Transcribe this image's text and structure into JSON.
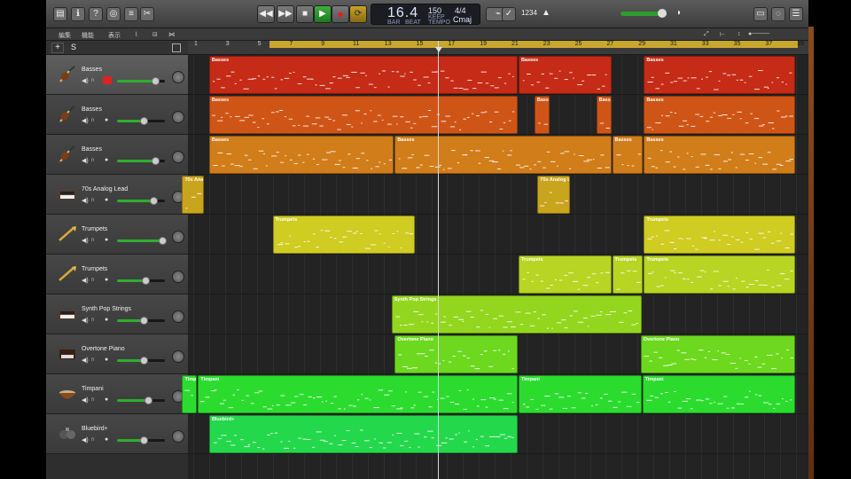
{
  "control_bar": {
    "lcd": {
      "position": "16.4",
      "position_bar_label": "BAR",
      "position_beat_label": "BEAT",
      "tempo": "150",
      "tempo_label": "KEEP",
      "tempo_sub": "TEMPO",
      "signature": "4/4",
      "key": "Cmaj"
    },
    "count_in": "1234"
  },
  "track_toolbar": {
    "menus": [
      "編集",
      "機能",
      "表示"
    ]
  },
  "addbar": {
    "plus": "+",
    "s": "S"
  },
  "ruler": {
    "bars": [
      "1",
      "3",
      "5",
      "7",
      "9",
      "11",
      "13",
      "15",
      "17",
      "19",
      "21",
      "23",
      "25",
      "27",
      "29",
      "31",
      "33",
      "35",
      "37",
      "39"
    ]
  },
  "tracks": [
    {
      "name": "Basses",
      "icon": "violin-icon",
      "color": "#c52b16",
      "volume": 0.8,
      "selected": true,
      "record": true
    },
    {
      "name": "Basses",
      "icon": "violin-icon",
      "color": "#cf5517",
      "volume": 0.55,
      "selected": false,
      "record": false
    },
    {
      "name": "Basses",
      "icon": "violin-icon",
      "color": "#d17d1a",
      "volume": 0.8,
      "selected": false,
      "record": false
    },
    {
      "name": "70s Analog Lead",
      "icon": "synth-icon",
      "color": "#c9a41d",
      "volume": 0.75,
      "selected": false,
      "record": false
    },
    {
      "name": "Trumpets",
      "icon": "trumpet-icon",
      "color": "#cfcc22",
      "volume": 0.95,
      "selected": false,
      "record": false
    },
    {
      "name": "Trumpets",
      "icon": "trumpet-icon",
      "color": "#b7d522",
      "volume": 0.6,
      "selected": false,
      "record": false
    },
    {
      "name": "Synth Pop Strings",
      "icon": "synth-icon",
      "color": "#93d61e",
      "volume": 0.55,
      "selected": false,
      "record": false
    },
    {
      "name": "Overtone Piano",
      "icon": "piano-icon",
      "color": "#6cd81e",
      "volume": 0.55,
      "selected": false,
      "record": false
    },
    {
      "name": "Timpani",
      "icon": "timpani-icon",
      "color": "#2bdc2f",
      "volume": 0.65,
      "selected": false,
      "record": false
    },
    {
      "name": "Bluebird+",
      "icon": "drum-icon",
      "color": "#24d84c",
      "volume": 0.55,
      "selected": false,
      "record": false
    }
  ],
  "regions": [
    [
      {
        "label": "Basses",
        "start": 2,
        "end": 21.5
      },
      {
        "label": "Basses",
        "start": 21.5,
        "end": 27.4
      },
      {
        "label": "Basses",
        "start": 29.4,
        "end": 39
      }
    ],
    [
      {
        "label": "Basses",
        "start": 2,
        "end": 21.5
      },
      {
        "label": "Bass",
        "start": 22.5,
        "end": 23.5
      },
      {
        "label": "Bass",
        "start": 26.4,
        "end": 27.4
      },
      {
        "label": "Basses",
        "start": 29.4,
        "end": 39
      }
    ],
    [
      {
        "label": "Basses",
        "start": 2,
        "end": 13.7
      },
      {
        "label": "Basses",
        "start": 13.7,
        "end": 27.4
      },
      {
        "label": "Basses",
        "start": 27.4,
        "end": 29.4
      },
      {
        "label": "Basses",
        "start": 29.4,
        "end": 39
      }
    ],
    [
      {
        "label": "70s Ana",
        "start": 0.3,
        "end": 1.7
      },
      {
        "label": "70s Analog L",
        "start": 22.7,
        "end": 24.8
      }
    ],
    [
      {
        "label": "Trumpets",
        "start": 6,
        "end": 15
      },
      {
        "label": "Trumpets",
        "start": 29.4,
        "end": 39
      }
    ],
    [
      {
        "label": "Trumpets",
        "start": 21.5,
        "end": 27.4
      },
      {
        "label": "Trumpets",
        "start": 27.4,
        "end": 29.4
      },
      {
        "label": "Trumpets",
        "start": 29.4,
        "end": 39
      }
    ],
    [
      {
        "label": "Synth Pop Strings",
        "start": 13.5,
        "end": 29.3
      }
    ],
    [
      {
        "label": "Overtone Piano",
        "start": 13.7,
        "end": 21.5
      },
      {
        "label": "Overtone Piano",
        "start": 29.2,
        "end": 39
      }
    ],
    [
      {
        "label": "Timp",
        "start": 0.3,
        "end": 1.3
      },
      {
        "label": "Timpani",
        "start": 1.3,
        "end": 21.5
      },
      {
        "label": "Timpani",
        "start": 21.5,
        "end": 29.3
      },
      {
        "label": "Timpani",
        "start": 29.3,
        "end": 39
      }
    ],
    [
      {
        "label": "Bluebird+",
        "start": 2,
        "end": 21.5
      }
    ]
  ],
  "playhead_bar": 16.4
}
